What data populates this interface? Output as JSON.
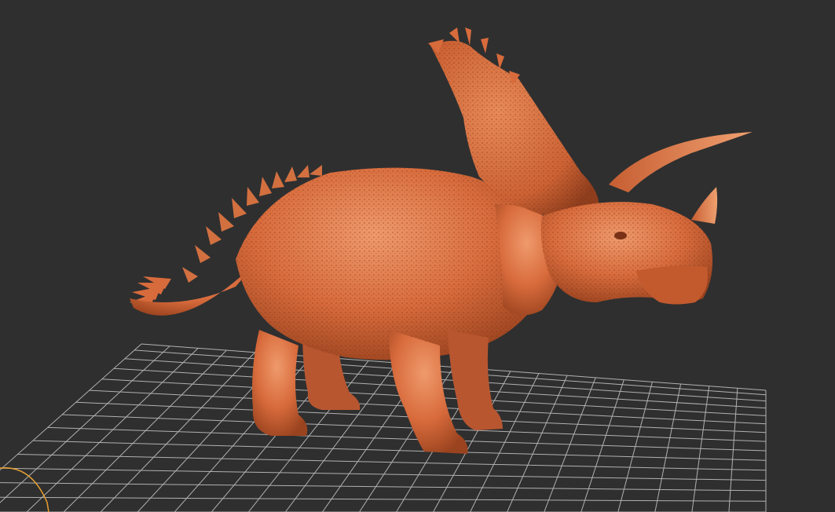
{
  "viewport": {
    "background": "#2f2f2f",
    "grid_color": "#c8c8c8",
    "model_color": "#d86b3c",
    "model_highlight": "#ef9a6c",
    "model_shadow": "#8a3b1c",
    "gizmo_color": "#e8a030"
  },
  "scene": {
    "model_icon": "triceratops-dinosaur-model",
    "ground_grid_icon": "ground-grid",
    "orbit_gizmo_icon": "orbit-gizmo-icon"
  }
}
